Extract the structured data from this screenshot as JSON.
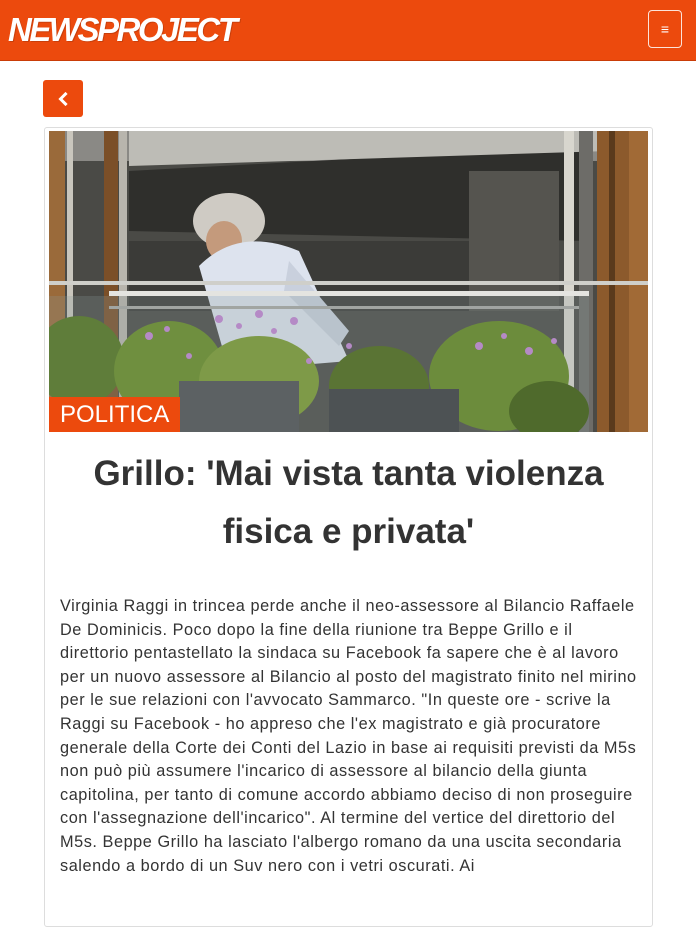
{
  "header": {
    "logo_text": "NEWSPROJECT",
    "menu_icon": "hamburger-icon",
    "accent_color": "#ec4a0d"
  },
  "nav": {
    "back_icon": "chevron-left-icon"
  },
  "article": {
    "category": "POLITICA",
    "title": "Grillo: 'Mai vista tanta violenza fisica e privata'",
    "body": "Virginia Raggi in trincea perde anche il neo-assessore al Bilancio Raffaele De Dominicis. Poco dopo la fine della riunione tra Beppe Grillo e il direttorio pentastellato la sindaca su Facebook fa sapere che è al lavoro per un nuovo assessore al Bilancio al posto del magistrato finito nel mirino per le sue relazioni con l'avvocato Sammarco. \"In queste ore - scrive la Raggi su Facebook - ho appreso che l'ex magistrato e già procuratore generale della Corte dei Conti del Lazio in base ai requisiti previsti da M5s non può più assumere l'incarico di assessore al bilancio della giunta capitolina, per tanto di comune accordo abbiamo deciso di non proseguire con l'assegnazione dell'incarico\".  Al termine del vertice del direttorio del M5s. Beppe Grillo ha lasciato l'albergo romano da una uscita secondaria salendo a bordo di un Suv nero con i vetri oscurati. Ai"
  }
}
